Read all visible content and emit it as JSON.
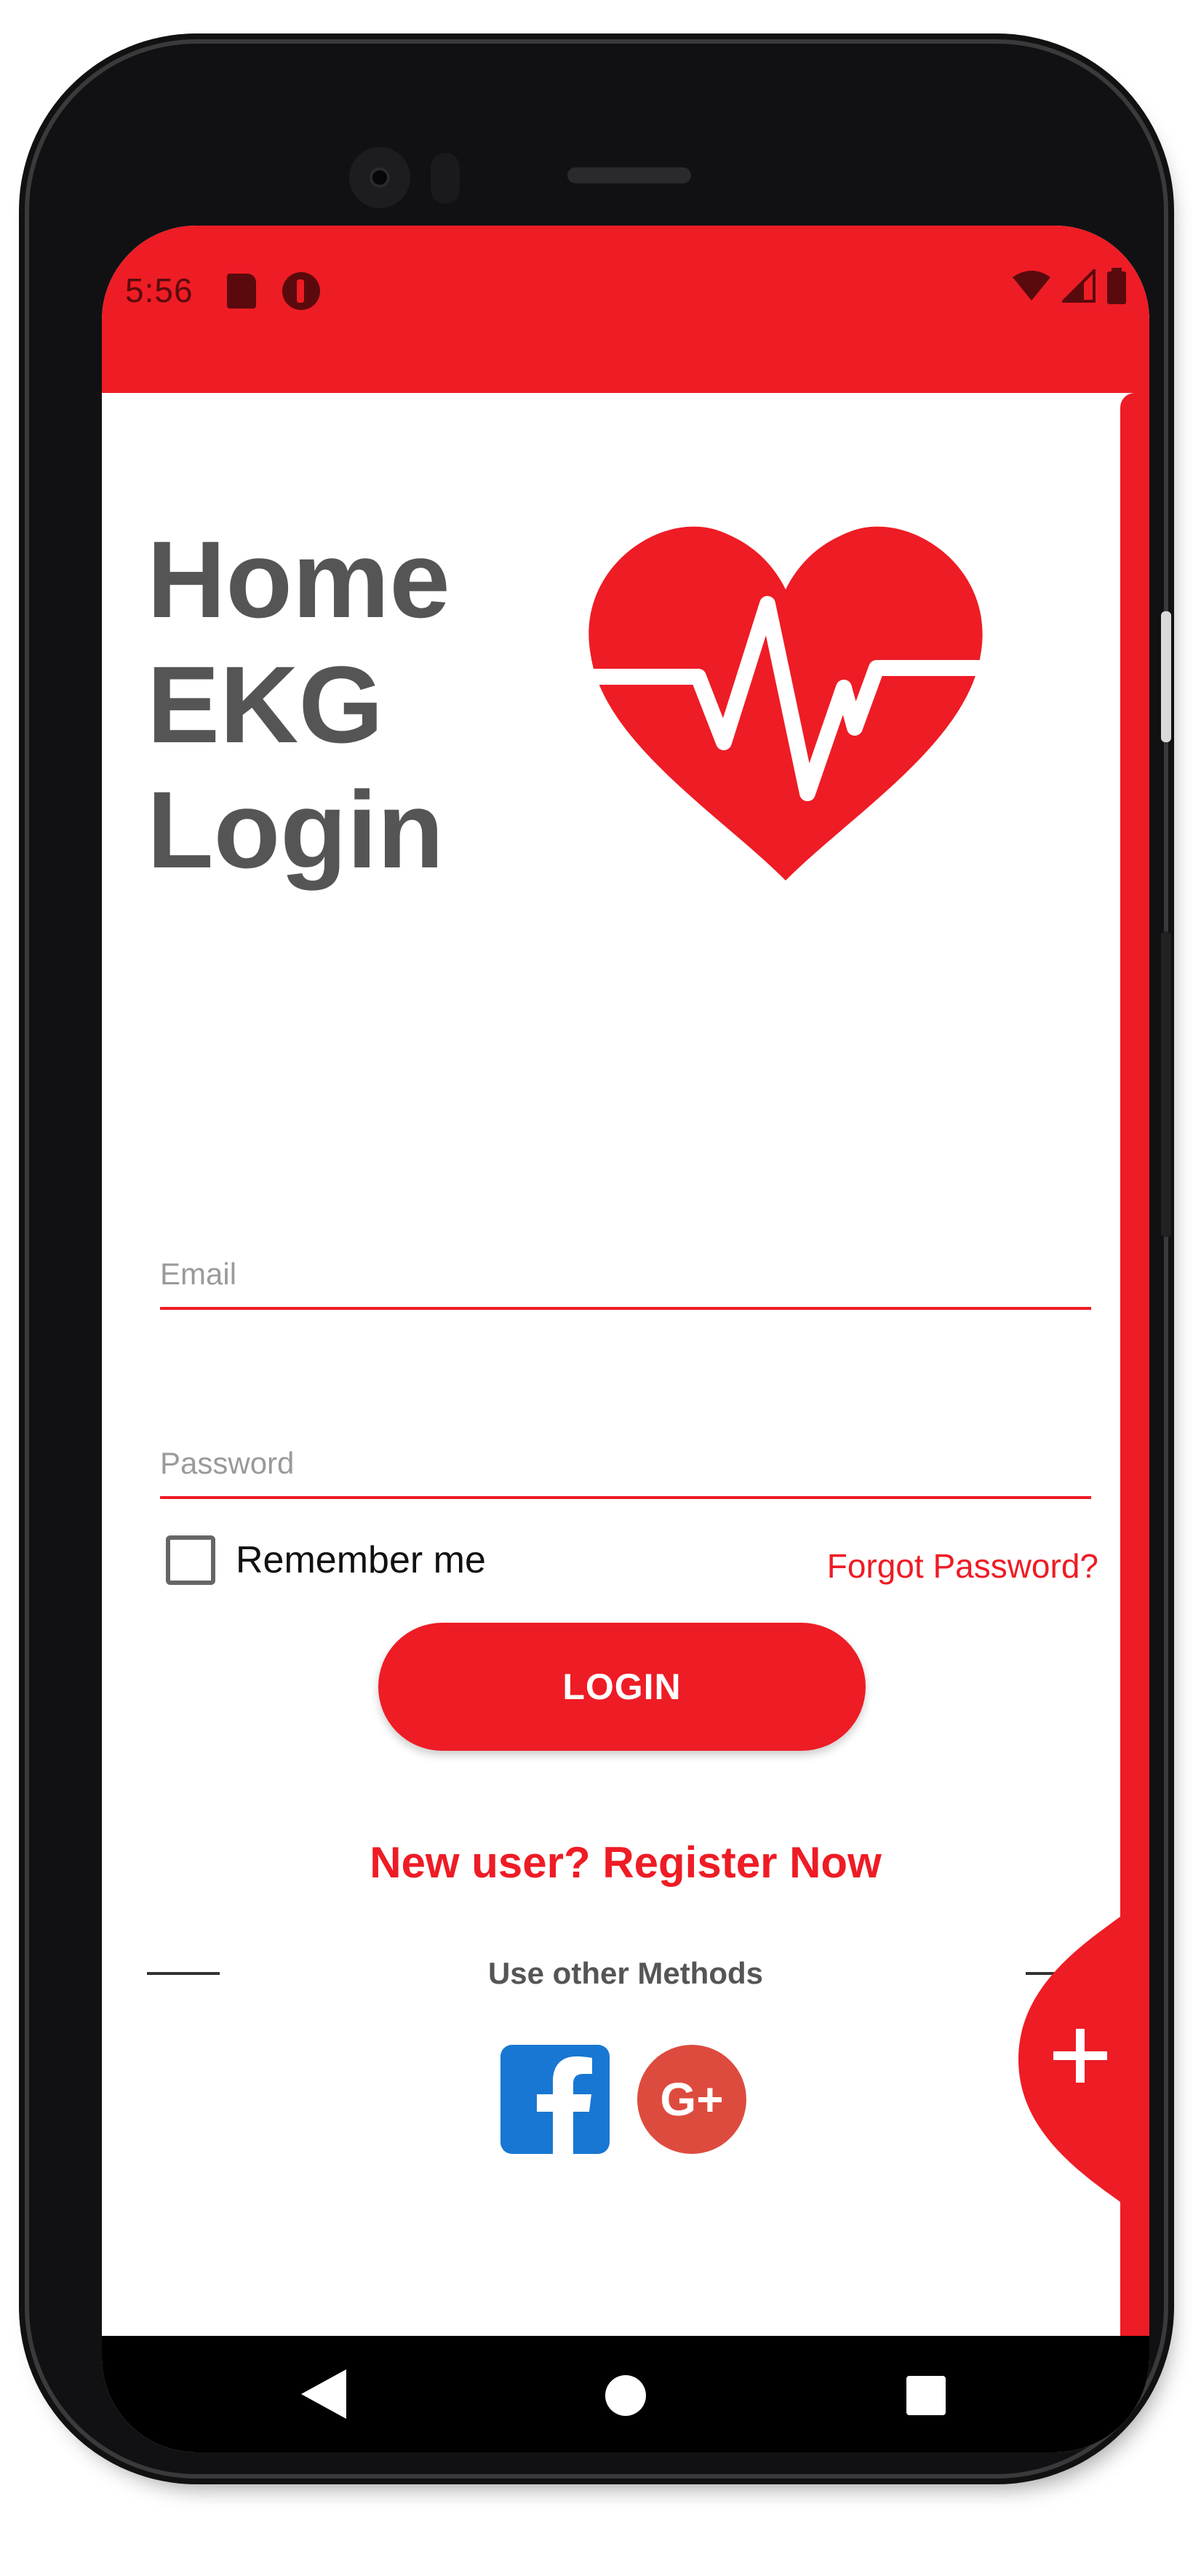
{
  "status_bar": {
    "time": "5:56",
    "icons": [
      "sd-card-icon",
      "app-notification-icon",
      "wifi-icon",
      "cell-signal-icon",
      "battery-icon"
    ]
  },
  "page": {
    "title_lines": [
      "Home",
      "EKG",
      "Login"
    ]
  },
  "form": {
    "email_placeholder": "Email",
    "password_placeholder": "Password",
    "remember_label": "Remember me",
    "forgot_label": "Forgot Password?",
    "login_label": "LOGIN",
    "register_label": "New user? Register Now"
  },
  "social": {
    "divider_label": "Use other Methods",
    "facebook_icon": "facebook-icon",
    "google_icon": "google-plus-icon",
    "google_text": "G+"
  },
  "fab": {
    "icon": "plus-icon"
  },
  "navigation": {
    "icons": [
      "back-icon",
      "home-icon",
      "recents-icon"
    ]
  },
  "colors": {
    "accent": "#ee1c25",
    "title_gray": "#555555",
    "facebook_blue": "#1877d2",
    "google_red": "#dd4b3e"
  }
}
